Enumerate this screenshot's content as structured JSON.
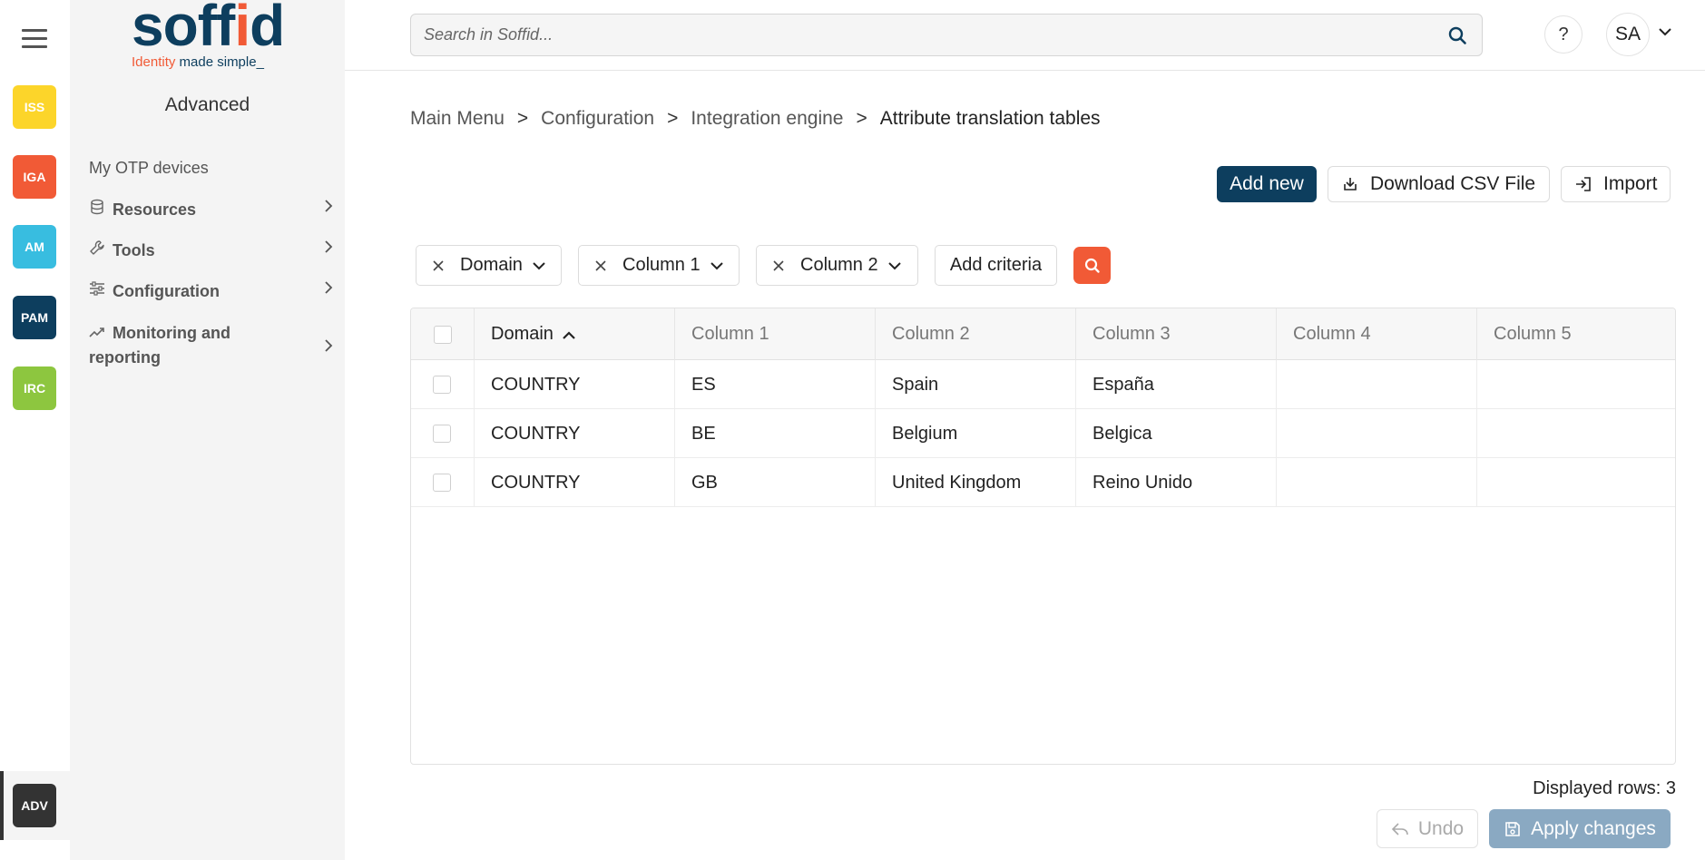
{
  "colors": {
    "brand_navy": "#0d3e5e",
    "brand_orange": "#f15a36",
    "apply_disabled": "#8aa9c2"
  },
  "rail": {
    "menu_icon": "hamburger-icon",
    "apps": [
      {
        "label": "ISS",
        "color": "#fcd52a"
      },
      {
        "label": "IGA",
        "color": "#f15a36"
      },
      {
        "label": "AM",
        "color": "#38bde0"
      },
      {
        "label": "PAM",
        "color": "#0d3e5e"
      },
      {
        "label": "IRC",
        "color": "#8dc63f"
      },
      {
        "label": "ADV",
        "color": "#333333"
      }
    ]
  },
  "logo": {
    "word_main": "soff",
    "word_i": "i",
    "word_d": "d",
    "tagline_a": "Identity",
    "tagline_b": " made simple_"
  },
  "sidebar": {
    "title": "Advanced",
    "items": [
      {
        "label": "My OTP devices",
        "icon": ""
      },
      {
        "label": "Resources",
        "icon": "database-icon"
      },
      {
        "label": "Tools",
        "icon": "wrench-icon"
      },
      {
        "label": "Configuration",
        "icon": "sliders-icon"
      },
      {
        "label": "Monitoring and",
        "label2": "reporting",
        "icon": "chart-line-icon"
      }
    ]
  },
  "topbar": {
    "search_placeholder": "Search in Soffid...",
    "help_label": "?",
    "user_initials": "SA"
  },
  "breadcrumb": [
    "Main Menu",
    "Configuration",
    "Integration engine",
    "Attribute translation tables"
  ],
  "breadcrumb_sep": ">",
  "actions": {
    "add_new": "Add new",
    "download_csv": "Download CSV File",
    "import": "Import"
  },
  "filters": {
    "chips": [
      "Domain",
      "Column 1",
      "Column 2"
    ],
    "add_criteria": "Add criteria"
  },
  "table": {
    "columns": [
      "Domain",
      "Column 1",
      "Column 2",
      "Column 3",
      "Column 4",
      "Column 5"
    ],
    "sort_column": "Domain",
    "rows": [
      [
        "COUNTRY",
        "ES",
        "Spain",
        "España",
        "",
        ""
      ],
      [
        "COUNTRY",
        "BE",
        "Belgium",
        "Belgica",
        "",
        ""
      ],
      [
        "COUNTRY",
        "GB",
        "United Kingdom",
        "Reino Unido",
        "",
        ""
      ]
    ]
  },
  "footer": {
    "displayed_rows": "Displayed rows: 3",
    "undo": "Undo",
    "apply": "Apply changes"
  }
}
